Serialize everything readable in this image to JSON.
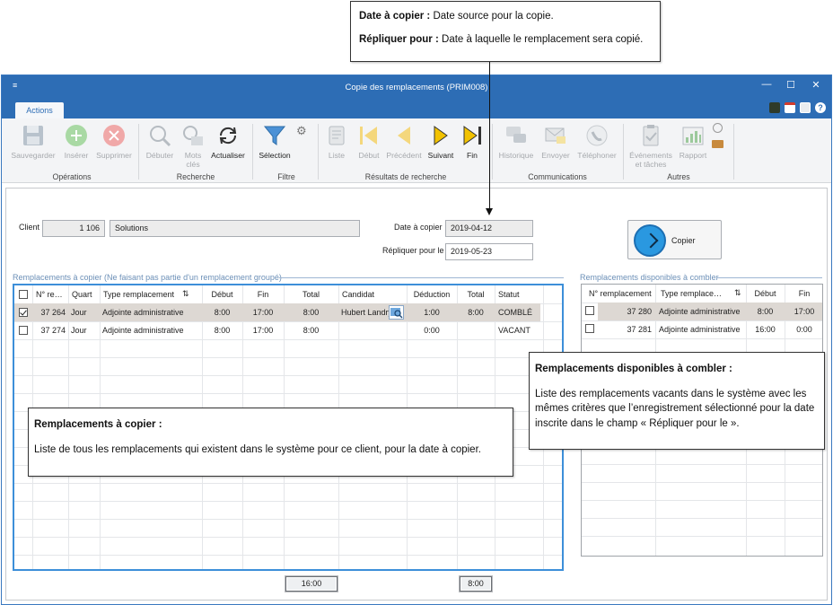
{
  "callouts": {
    "top": {
      "line1_bold": "Date à copier :",
      "line1_text": " Date source pour la copie.",
      "line2_bold": "Répliquer pour :",
      "line2_text": " Date à laquelle le remplacement sera copié."
    },
    "left": {
      "title": "Remplacements à copier :",
      "text": "Liste de tous les remplacements qui existent dans le système pour ce client, pour la date à copier."
    },
    "right": {
      "title": "Remplacements disponibles à combler :",
      "text": "Liste des remplacements vacants dans le système avec les mêmes critères que l’enregistrement sélectionné pour la date inscrite dans le champ « Répliquer pour le »."
    }
  },
  "window": {
    "title": "Copie des remplacements (PRIM008)",
    "sysmenu": "≡",
    "minimize": "—",
    "maximize": "☐",
    "close": "✕",
    "tab": "Actions"
  },
  "ribbon": {
    "save": "Sauvegarder",
    "insert": "Insérer",
    "delete": "Supprimer",
    "start": "Débuter",
    "keywords_1": "Mots",
    "keywords_2": "clés",
    "refresh": "Actualiser",
    "selection": "Sélection",
    "list": "Liste",
    "first": "Début",
    "previous": "Précédent",
    "next": "Suivant",
    "last": "Fin",
    "history": "Historique",
    "send": "Envoyer",
    "phone": "Téléphoner",
    "events_1": "Événements",
    "events_2": "et tâches",
    "report": "Rapport",
    "groups": {
      "operations": "Opérations",
      "search": "Recherche",
      "filter": "Filtre",
      "results": "Résultats de recherche",
      "communications": "Communications",
      "others": "Autres"
    }
  },
  "form": {
    "client_label": "Client",
    "client_number": "1 106",
    "client_name": "Solutions",
    "date_copy_label": "Date à copier",
    "date_copy_value": "2019-04-12",
    "replicate_label": "Répliquer pour le",
    "replicate_value": "2019-05-23",
    "copy_button": "Copier"
  },
  "left_grid": {
    "section_title": "Remplacements à copier (Ne faisant pas partie d'un remplacement groupé)",
    "headers": {
      "num": "N° re…",
      "shift": "Quart",
      "type": "Type remplacement",
      "start": "Début",
      "end": "Fin",
      "total": "Total",
      "candidate": "Candidat",
      "deduction": "Déduction",
      "total2": "Total",
      "status": "Statut"
    },
    "rows": [
      {
        "num": "37 264",
        "shift": "Jour",
        "type": "Adjointe administrative",
        "start": "8:00",
        "end": "17:00",
        "total": "8:00",
        "candidate": "Hubert Landry",
        "deduction": "1:00",
        "total2": "8:00",
        "status": "COMBLÉ"
      },
      {
        "num": "37 274",
        "shift": "Jour",
        "type": "Adjointe administrative",
        "start": "8:00",
        "end": "17:00",
        "total": "8:00",
        "candidate": "",
        "deduction": "0:00",
        "total2": "",
        "status": "VACANT"
      }
    ],
    "sum_total": "16:00",
    "sum_total2": "8:00"
  },
  "right_grid": {
    "section_title": "Remplacements disponibles à combler",
    "headers": {
      "num": "N° remplacement",
      "type": "Type remplace…",
      "start": "Début",
      "end": "Fin"
    },
    "rows": [
      {
        "num": "37 280",
        "type": "Adjointe administrative",
        "start": "8:00",
        "end": "17:00"
      },
      {
        "num": "37 281",
        "type": "Adjointe administrative",
        "start": "16:00",
        "end": "0:00"
      }
    ]
  }
}
